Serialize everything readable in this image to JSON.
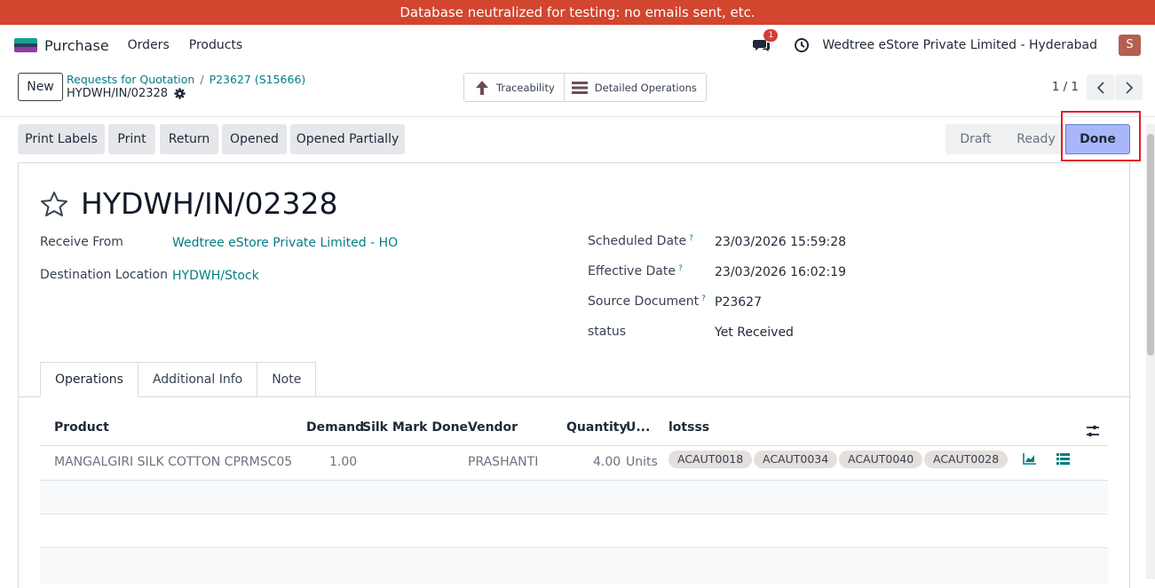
{
  "banner": {
    "text": "Database neutralized for testing: no emails sent, etc."
  },
  "navbar": {
    "app_name": "Purchase",
    "menu": [
      "Orders",
      "Products"
    ],
    "message_count": "1",
    "company": "Wedtree eStore Private Limited - Hyderabad",
    "avatar_letter": "S"
  },
  "control_panel": {
    "new_label": "New",
    "breadcrumb": [
      "Requests for Quotation",
      "P23627 (S15666)"
    ],
    "record_name": "HYDWH/IN/02328",
    "smart_buttons": [
      "Traceability",
      "Detailed Operations"
    ],
    "pager": "1 / 1"
  },
  "actions": [
    "Print Labels",
    "Print",
    "Return",
    "Opened",
    "Opened Partially"
  ],
  "stages": [
    "Draft",
    "Ready",
    "Done"
  ],
  "active_stage": "Done",
  "form": {
    "title": "HYDWH/IN/02328",
    "receive_from_label": "Receive From",
    "receive_from": "Wedtree eStore Private Limited - HO",
    "destination_label": "Destination Location",
    "destination": "HYDWH/Stock",
    "scheduled_label": "Scheduled Date",
    "scheduled": "23/03/2026 15:59:28",
    "effective_label": "Effective Date",
    "effective": "23/03/2026 16:02:19",
    "source_label": "Source Document",
    "source": "P23627",
    "status_label": "status",
    "status": "Yet Received",
    "help_mark": "?"
  },
  "tabs": [
    "Operations",
    "Additional Info",
    "Note"
  ],
  "table": {
    "headers": {
      "product": "Product",
      "demand": "Demand",
      "silk": "Silk Mark Done",
      "vendor": "Vendor",
      "quantity": "Quantity",
      "uom": "U...",
      "lots": "lotsss"
    },
    "rows": [
      {
        "product": "MANGALGIRI SILK COTTON CPRMSC05",
        "demand": "1.00",
        "vendor": "PRASHANTI",
        "quantity": "4.00",
        "uom": "Units",
        "lots": [
          "ACAUT0018",
          "ACAUT0034",
          "ACAUT0040",
          "ACAUT0028"
        ]
      }
    ]
  },
  "colors": {
    "banner": "#d2452e",
    "link": "#017e84",
    "done_stage": "#a7b7f8",
    "highlight": "#e11d2a"
  }
}
